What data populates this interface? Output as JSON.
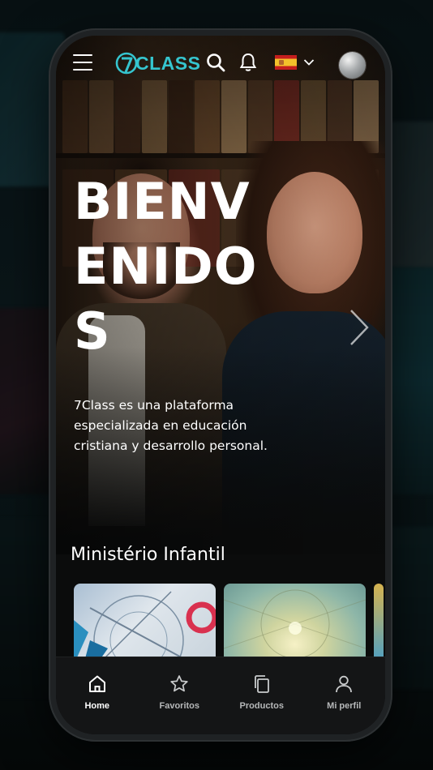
{
  "header": {
    "brand": "CLASS",
    "language_flag": "spain-flag-icon"
  },
  "hero": {
    "title": "BIENVENIDOS",
    "description": "7Class es una plataforma especializada en educación cristiana y desarrollo personal."
  },
  "section": {
    "title": "Ministério Infantil",
    "cards": [
      {
        "name": "course-card-1"
      },
      {
        "name": "course-card-2"
      },
      {
        "name": "course-card-3"
      }
    ]
  },
  "bottom_nav": {
    "items": [
      {
        "label": "Home",
        "icon": "home-icon",
        "active": true
      },
      {
        "label": "Favoritos",
        "icon": "star-icon",
        "active": false
      },
      {
        "label": "Productos",
        "icon": "copy-icon",
        "active": false
      },
      {
        "label": "Mi perfil",
        "icon": "user-icon",
        "active": false
      }
    ]
  },
  "colors": {
    "brand": "#35c5cf",
    "nav_bg": "#141516",
    "text": "#ffffff"
  }
}
